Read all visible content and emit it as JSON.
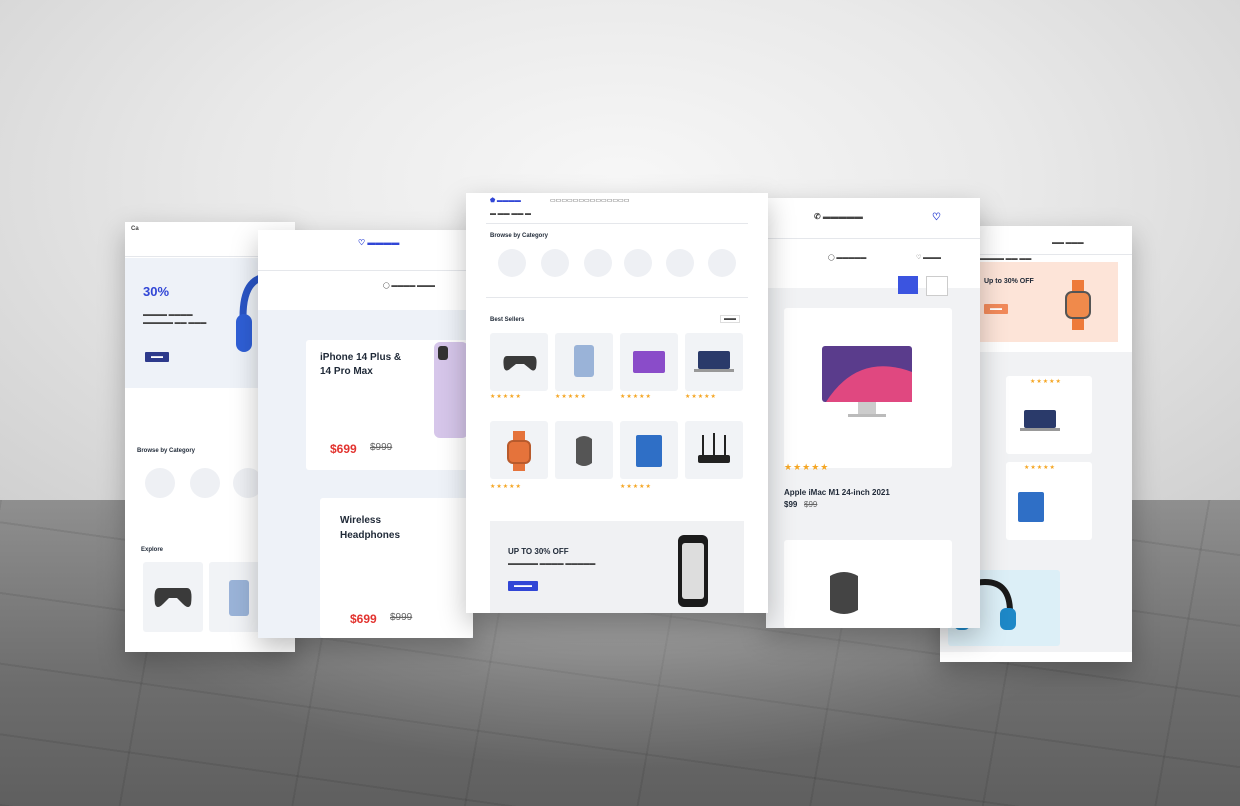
{
  "scene": {
    "wall_color": "#eeeeee",
    "floor_color": "#7a7a7a"
  },
  "page1": {
    "discount": "30%",
    "category_title": "Browse by Category",
    "section_title": "Explore",
    "icons": [
      "headphones-icon",
      "gamepad-icon",
      "phone-icon",
      "tablet-icon"
    ]
  },
  "page2": {
    "hero_title_line1": "iPhone 14 Plus &",
    "hero_title_line2": "14 Pro Max",
    "price_new": "$699",
    "price_old": "$999",
    "card2_title_line1": "Wireless",
    "card2_title_line2": "Headphones",
    "price2_new": "$699",
    "price2_old": "$999",
    "accent": "#e2332f"
  },
  "page3": {
    "category_title": "Browse by Category",
    "section_title": "Best Sellers",
    "promo_title": "UP TO 30% OFF",
    "products": [
      "gamepad",
      "iphone",
      "ipad-pro",
      "macbook",
      "watch",
      "mouse",
      "ipad-air",
      "router"
    ],
    "accent": "#3146d6"
  },
  "page4": {
    "product_title": "Apple iMac M1 24-inch 2021",
    "price_new": "$99",
    "price_old": "$99",
    "accent": "#3b54e0"
  },
  "page5": {
    "promo_title": "Up to 30% OFF",
    "promo_color": "#f6a98b"
  }
}
